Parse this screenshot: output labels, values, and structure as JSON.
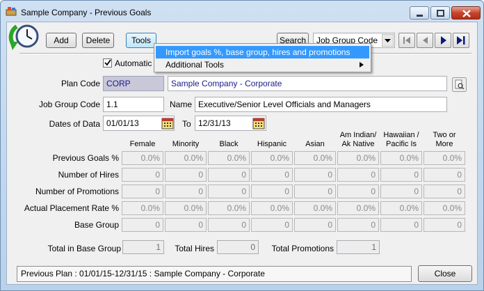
{
  "window": {
    "title": "Sample Company - Previous Goals",
    "controls": [
      "minimize",
      "maximize",
      "close"
    ]
  },
  "toolbar": {
    "add_label": "Add",
    "delete_label": "Delete",
    "tools_label": "Tools",
    "search_label": "Search",
    "search_field_value": "Job Group Code",
    "nav_buttons": [
      "first",
      "previous",
      "next",
      "last"
    ]
  },
  "tools_menu": {
    "items": [
      {
        "label": "Import goals %, base group, hires and promotions",
        "highlighted": true
      },
      {
        "label": "Additional Tools",
        "has_submenu": true
      }
    ]
  },
  "automatic": {
    "label": "Automatic",
    "checked": true
  },
  "form": {
    "plan_code_label": "Plan Code",
    "plan_code_value": "CORP",
    "plan_name_value": "Sample Company - Corporate",
    "job_group_label": "Job Group Code",
    "job_group_value": "1.1",
    "name_label": "Name",
    "name_value": "Executive/Senior Level Officials and Managers",
    "dates_label": "Dates of Data",
    "date_from": "01/01/13",
    "to_label": "To",
    "date_to": "12/31/13"
  },
  "goals_table": {
    "columns": [
      "Female",
      "Minority",
      "Black",
      "Hispanic",
      "Asian",
      "Am Indian/\nAk Native",
      "Hawaiian /\nPacific Is",
      "Two or\nMore"
    ],
    "rows": [
      {
        "label": "Previous Goals %",
        "values": [
          "0.0%",
          "0.0%",
          "0.0%",
          "0.0%",
          "0.0%",
          "0.0%",
          "0.0%",
          "0.0%"
        ]
      },
      {
        "label": "Number of Hires",
        "values": [
          "0",
          "0",
          "0",
          "0",
          "0",
          "0",
          "0",
          "0"
        ]
      },
      {
        "label": "Number of Promotions",
        "values": [
          "0",
          "0",
          "0",
          "0",
          "0",
          "0",
          "0",
          "0"
        ]
      },
      {
        "label": "Actual Placement Rate %",
        "values": [
          "0.0%",
          "0.0%",
          "0.0%",
          "0.0%",
          "0.0%",
          "0.0%",
          "0.0%",
          "0.0%"
        ]
      },
      {
        "label": "Base Group",
        "values": [
          "0",
          "0",
          "0",
          "0",
          "0",
          "0",
          "0",
          "0"
        ]
      }
    ]
  },
  "totals": {
    "base_group_label": "Total in Base Group",
    "base_group_value": "1",
    "hires_label": "Total Hires",
    "hires_value": "0",
    "promotions_label": "Total Promotions",
    "promotions_value": "1"
  },
  "status": {
    "text": "Previous Plan : 01/01/15-12/31/15 : Sample Company - Corporate"
  },
  "footer": {
    "close_label": "Close"
  },
  "colors": {
    "title_bar": "#bcd3ec",
    "menu_highlight": "#3399ff",
    "readonly_code_bg": "#c8c8d8",
    "link_text": "#1a1a8c"
  }
}
